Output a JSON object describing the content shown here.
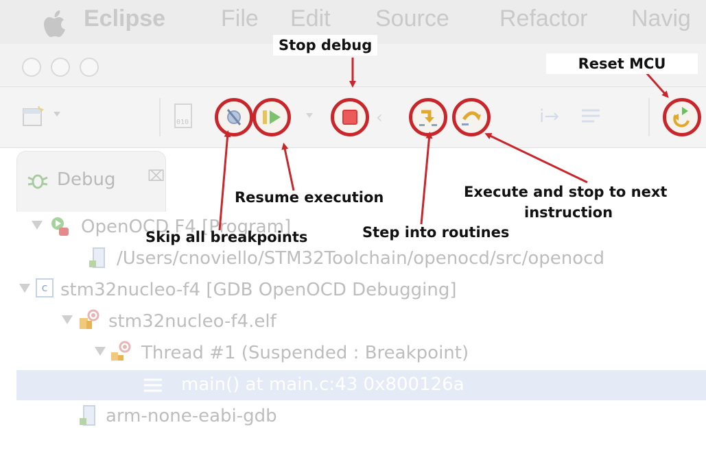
{
  "menubar": {
    "app": "Eclipse",
    "items": [
      "File",
      "Edit",
      "Source",
      "Refactor",
      "Navig"
    ]
  },
  "debug_view": {
    "tab_label": "Debug",
    "close_glyph": "⌧",
    "tree": [
      {
        "text": "OpenOCD F4 [Program]",
        "icon": "launch-icon"
      },
      {
        "text": "/Users/cnoviello/STM32Toolchain/openocd/src/openocd",
        "icon": "process-icon"
      },
      {
        "text": "stm32nucleo-f4 [GDB OpenOCD Debugging]",
        "icon": "c-app-icon"
      },
      {
        "text": "stm32nucleo-f4.elf",
        "icon": "elf-icon"
      },
      {
        "text": "Thread #1 (Suspended : Breakpoint)",
        "icon": "thread-icon"
      },
      {
        "text": "main() at main.c:43 0x800126a",
        "icon": "stack-frame-icon",
        "selected": true
      },
      {
        "text": "arm-none-eabi-gdb",
        "icon": "process-icon"
      }
    ]
  },
  "annotations": {
    "stop_debug": "Stop debug",
    "reset_mcu": "Reset MCU",
    "resume": "Resume execution",
    "skip_breakpoints": "Skip all breakpoints",
    "step_into": "Step into routines",
    "step_over_line1": "Execute and stop to next",
    "step_over_line2": "instruction"
  },
  "colors": {
    "highlight": "#c8262a",
    "arrow": "#c8262a",
    "selection": "#e4ebf7"
  }
}
